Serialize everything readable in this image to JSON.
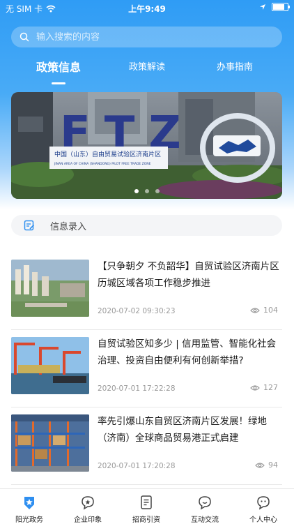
{
  "status_bar": {
    "carrier": "无 SIM 卡",
    "time": "上午9:49"
  },
  "search": {
    "placeholder": "输入搜索的内容"
  },
  "tabs": [
    {
      "label": "政策信息",
      "active": true
    },
    {
      "label": "政策解读",
      "active": false
    },
    {
      "label": "办事指南",
      "active": false
    }
  ],
  "banner": {
    "sign_title": "中国（山东）自由贸易试验区济南片区",
    "sign_subtitle": "JINAN AREA OF CHINA (SHANDONG) PILOT FREE TRADE ZONE",
    "big_letters": "FTZ",
    "page_count": 3,
    "active_page": 1
  },
  "info_entry": {
    "label": "信息录入",
    "icon": "form-edit-icon"
  },
  "news": [
    {
      "title": "【只争朝夕 不负韶华】自贸试验区济南片区历城区域各项工作稳步推进",
      "date": "2020-07-02 09:30:23",
      "views": "104"
    },
    {
      "title": "自贸试验区知多少 | 信用监管、智能化社会治理、投资自由便利有何创新举措?",
      "date": "2020-07-01 17:22:28",
      "views": "127"
    },
    {
      "title": "率先引爆山东自贸区济南片区发展！绿地（济南）全球商品贸易港正式启建",
      "date": "2020-07-01 17:20:28",
      "views": "94"
    }
  ],
  "tab_bar": [
    {
      "label": "阳光政务",
      "icon": "star-shield-icon",
      "active": true
    },
    {
      "label": "企业印象",
      "icon": "favorite-bubble-icon",
      "active": false
    },
    {
      "label": "招商引资",
      "icon": "document-icon",
      "active": false
    },
    {
      "label": "互动交流",
      "icon": "chat-bubble-icon",
      "active": false
    },
    {
      "label": "个人中心",
      "icon": "user-bubble-icon",
      "active": false
    }
  ],
  "colors": {
    "primary": "#2f9cf5",
    "active_tab_icon": "#2f8ff0"
  }
}
